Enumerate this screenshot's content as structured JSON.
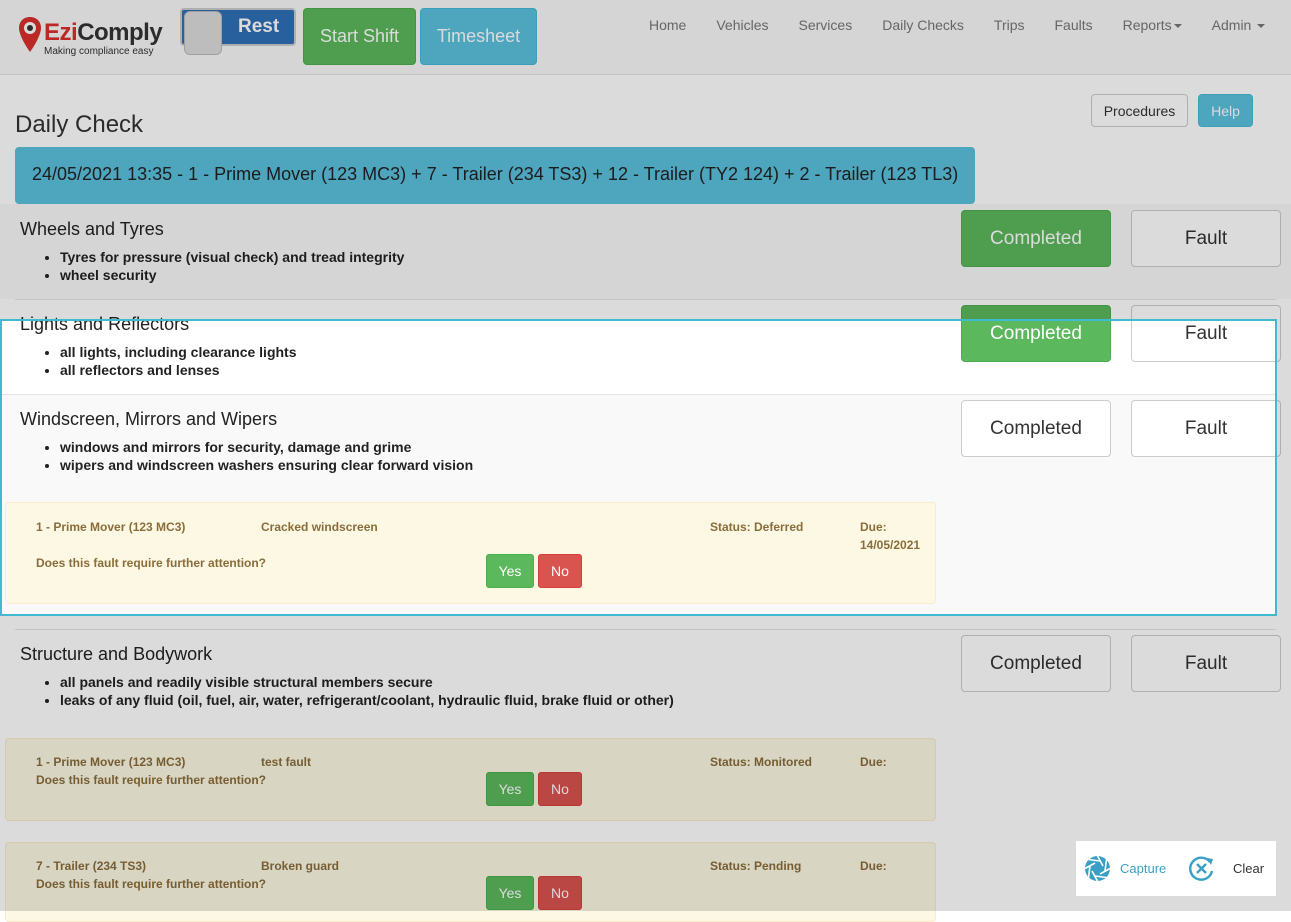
{
  "brand": {
    "name_part1": "Ezi",
    "name_part2": "Comply",
    "tagline": "Making compliance easy"
  },
  "toolbar": {
    "toggle_label": "Rest",
    "start_shift": "Start Shift",
    "timesheet": "Timesheet"
  },
  "nav": {
    "items": [
      "Home",
      "Vehicles",
      "Services",
      "Daily Checks",
      "Trips",
      "Faults",
      "Reports",
      "Admin"
    ]
  },
  "page": {
    "title": "Daily Check",
    "procedures": "Procedures",
    "help": "Help",
    "banner": "24/05/2021 13:35 - 1 - Prime Mover (123 MC3) + 7 - Trailer (234 TS3) + 12 - Trailer (TY2 124) + 2 - Trailer (123 TL3)"
  },
  "labels": {
    "completed": "Completed",
    "fault": "Fault",
    "question": "Does this fault require further attention?",
    "yes": "Yes",
    "no": "No",
    "due": "Due:"
  },
  "sections": [
    {
      "title": "Wheels and Tyres",
      "items": [
        "Tyres for pressure (visual check) and tread integrity",
        "wheel security"
      ]
    },
    {
      "title": "Lights and Reflectors",
      "items": [
        "all lights, including clearance lights",
        "all reflectors and lenses"
      ]
    },
    {
      "title": "Windscreen, Mirrors and Wipers",
      "items": [
        "windows and mirrors for security, damage and grime",
        "wipers and windscreen washers ensuring clear forward vision"
      ]
    },
    {
      "title": "Structure and Bodywork",
      "items": [
        "all panels and readily visible structural members secure",
        "leaks of any fluid (oil, fuel, air, water, refrigerant/coolant, hydraulic fluid, brake fluid or other)"
      ]
    }
  ],
  "faults": [
    {
      "vehicle": "1 - Prime Mover (123 MC3)",
      "description": "Cracked windscreen",
      "status": "Status: Deferred",
      "due_date": "14/05/2021"
    },
    {
      "vehicle": "1 - Prime Mover (123 MC3)",
      "description": "test fault",
      "status": "Status: Monitored",
      "due_date": ""
    },
    {
      "vehicle": "7 - Trailer (234 TS3)",
      "description": "Broken guard",
      "status": "Status: Pending",
      "due_date": ""
    }
  ],
  "capture": {
    "capture_label": "Capture",
    "clear_label": "Clear"
  },
  "colors": {
    "success": "#5cb85c",
    "info": "#5bc0de",
    "danger": "#d9534f",
    "warning_bg": "#fcf8e3",
    "selection": "#3ebbd0"
  }
}
